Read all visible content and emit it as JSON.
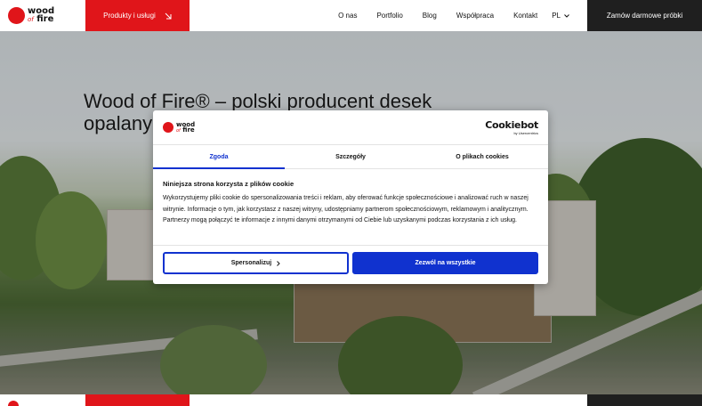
{
  "header": {
    "logo": {
      "word1": "wood",
      "word2": "of",
      "word3": "fire"
    },
    "products_label": "Produkty i usługi",
    "nav": [
      "O nas",
      "Portfolio",
      "Blog",
      "Współpraca",
      "Kontakt"
    ],
    "lang": "PL",
    "cta_label": "Zamów darmowe próbki"
  },
  "hero": {
    "title_line1": "Wood of Fire® – polski producent desek",
    "title_line2": "opalany"
  },
  "cookie": {
    "brand": "Cookiebot",
    "brand_sub": "by Usercentrics",
    "tabs": [
      "Zgoda",
      "Szczegóły",
      "O plikach cookies"
    ],
    "heading": "Niniejsza strona korzysta z plików cookie",
    "text": "Wykorzystujemy pliki cookie do spersonalizowania treści i reklam, aby oferować funkcje społecznościowe i analizować ruch w naszej witrynie. Informacje o tym, jak korzystasz z naszej witryny, udostępniamy partnerom społecznościowym, reklamowym i analitycznym. Partnerzy mogą połączyć te informacje z innymi danymi otrzymanymi od Ciebie lub uzyskanymi podczas korzystania z ich usług.",
    "customize_label": "Spersonalizuj",
    "allow_label": "Zezwól na wszystkie"
  },
  "colors": {
    "brand_red": "#e0151a",
    "dark": "#1f1f1f",
    "cookie_blue": "#1032cf"
  }
}
